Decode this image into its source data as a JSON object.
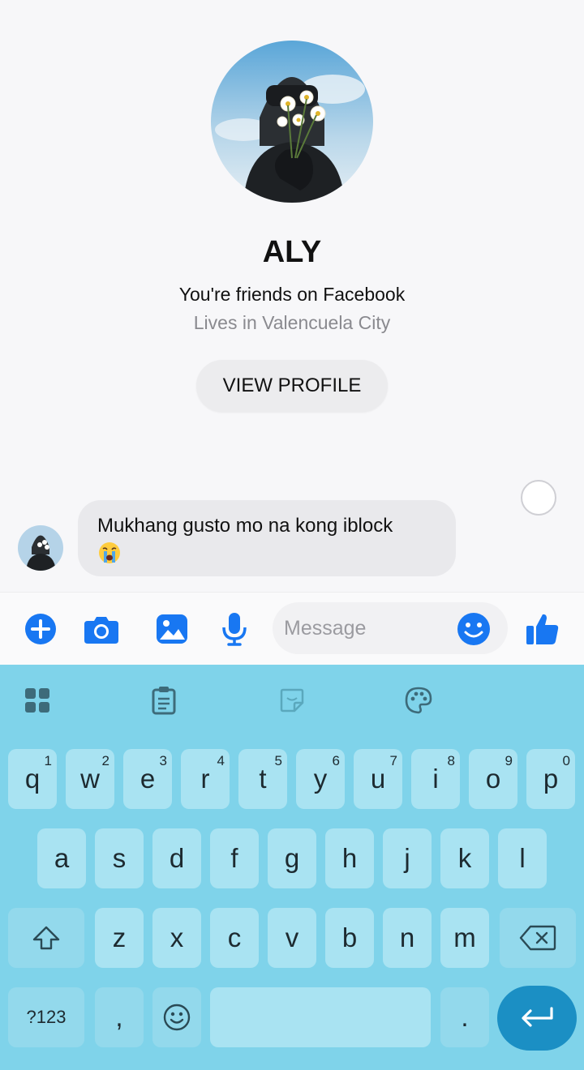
{
  "contact": {
    "name": "ALY",
    "friend_status": "You're friends on Facebook",
    "location": "Lives in Valencuela City",
    "view_profile_label": "VIEW PROFILE"
  },
  "messages": [
    {
      "text": "Mukhang gusto mo na kong iblock",
      "emoji": "crying-face"
    }
  ],
  "composer": {
    "placeholder": "Message",
    "icons": [
      "plus-icon",
      "camera-icon",
      "gallery-icon",
      "microphone-icon",
      "emoji-icon",
      "thumbs-up-icon"
    ]
  },
  "keyboard": {
    "toolbar": [
      "apps-grid-icon",
      "clipboard-icon",
      "sticker-icon",
      "palette-icon"
    ],
    "row1": [
      {
        "k": "q",
        "n": "1"
      },
      {
        "k": "w",
        "n": "2"
      },
      {
        "k": "e",
        "n": "3"
      },
      {
        "k": "r",
        "n": "4"
      },
      {
        "k": "t",
        "n": "5"
      },
      {
        "k": "y",
        "n": "6"
      },
      {
        "k": "u",
        "n": "7"
      },
      {
        "k": "i",
        "n": "8"
      },
      {
        "k": "o",
        "n": "9"
      },
      {
        "k": "p",
        "n": "0"
      }
    ],
    "row2": [
      "a",
      "s",
      "d",
      "f",
      "g",
      "h",
      "j",
      "k",
      "l"
    ],
    "row3": [
      "z",
      "x",
      "c",
      "v",
      "b",
      "n",
      "m"
    ],
    "symbols_label": "?123",
    "comma": ",",
    "period": "."
  },
  "colors": {
    "messenger_blue": "#1877f2",
    "keyboard_bg": "#7fd3ea",
    "key_bg": "#a9e3f2",
    "enter_bg": "#1b8fc4"
  }
}
